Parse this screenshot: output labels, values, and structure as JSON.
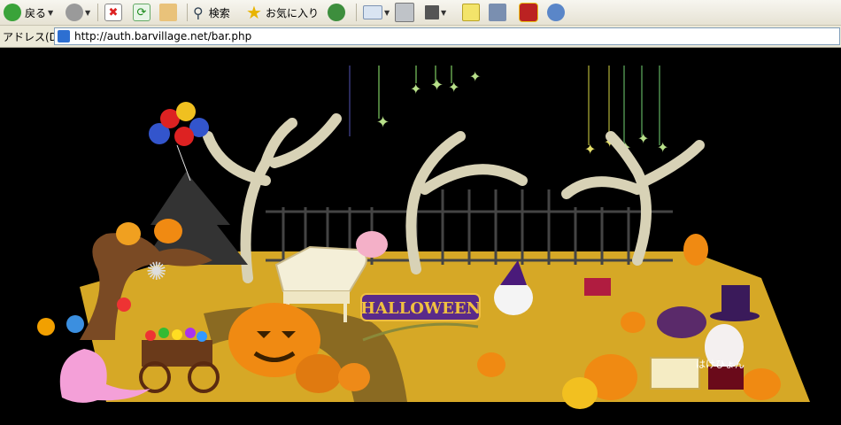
{
  "toolbar": {
    "back_label": "戻る",
    "search_label": "検索",
    "favorites_label": "お気に入り"
  },
  "address": {
    "label": "アドレス(D)",
    "url": "http://auth.barvillage.net/bar.php"
  },
  "scene": {
    "sign_text": "HALLOWEEN",
    "nickname": "はけひょん"
  },
  "colors": {
    "ground": "#d6a826",
    "path": "#8a6a22",
    "pumpkin": "#f08a12",
    "tree": "#d8d2b6",
    "sign_bg": "#5a2a8a",
    "sign_text": "#f0c040"
  }
}
